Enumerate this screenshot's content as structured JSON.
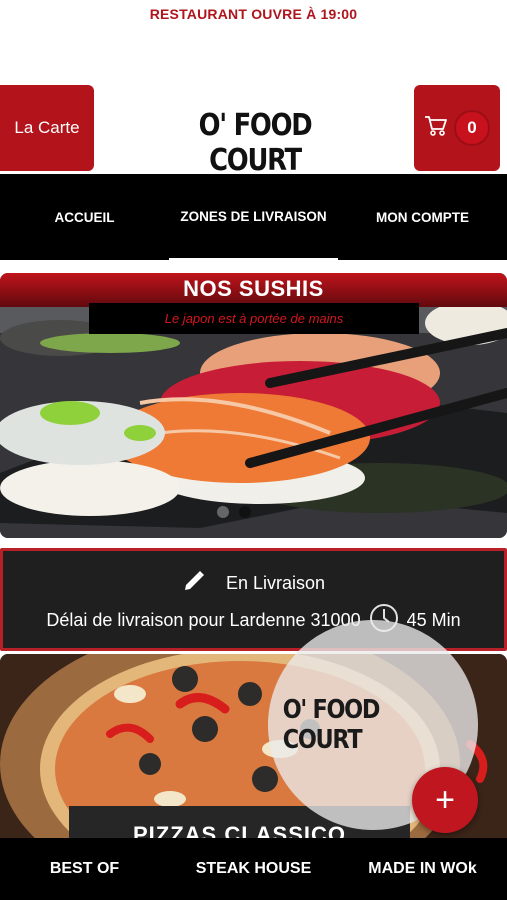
{
  "status_banner": "RESTAURANT OUVRE À 19:00",
  "header": {
    "menu_button_label": "La Carte",
    "logo_text": "O' FOOD COURT",
    "cart_count": "0"
  },
  "nav": {
    "items": [
      {
        "label": "ACCUEIL"
      },
      {
        "label": "ZONES DE LIVRAISON"
      },
      {
        "label": "MON COMPTE"
      }
    ],
    "active_index": 1
  },
  "hero": {
    "title": "NOS SUSHIS",
    "subtitle": "Le japon est à portée de mains",
    "slide_count": 2,
    "active_slide": 2
  },
  "delivery": {
    "mode": "En Livraison",
    "delay_text": "Délai de livraison pour Lardenne 31000",
    "delay_value": "45 Min"
  },
  "category_card": {
    "label": "PIZZAS CLASSICO",
    "logo_text": "O' FOOD COURT"
  },
  "fab_label": "+",
  "bottom_nav": {
    "items": [
      {
        "label": "BEST OF"
      },
      {
        "label": "STEAK HOUSE"
      },
      {
        "label": "MADE IN WOk"
      }
    ]
  },
  "colors": {
    "brand_red": "#b3141b",
    "nav_bg": "#000000",
    "panel_bg": "#1f1f1f"
  },
  "icons": [
    "cart-icon",
    "pencil-icon",
    "clock-icon",
    "plus-icon"
  ]
}
